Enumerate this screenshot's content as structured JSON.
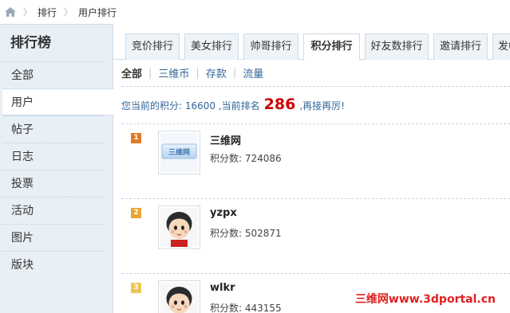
{
  "breadcrumb": {
    "items": [
      "排行",
      "用户排行"
    ],
    "separator": "〉"
  },
  "sidebar": {
    "title": "排行榜",
    "items": [
      {
        "label": "全部"
      },
      {
        "label": "用户"
      },
      {
        "label": "帖子"
      },
      {
        "label": "日志"
      },
      {
        "label": "投票"
      },
      {
        "label": "活动"
      },
      {
        "label": "图片"
      },
      {
        "label": "版块"
      }
    ],
    "active_index": 1
  },
  "tabs": {
    "items": [
      {
        "label": "竞价排行"
      },
      {
        "label": "美女排行"
      },
      {
        "label": "帅哥排行"
      },
      {
        "label": "积分排行"
      },
      {
        "label": "好友数排行"
      },
      {
        "label": "邀请排行"
      },
      {
        "label": "发帖"
      }
    ],
    "active_index": 3
  },
  "subnav": {
    "items": [
      {
        "label": "全部"
      },
      {
        "label": "三维币"
      },
      {
        "label": "存款"
      },
      {
        "label": "流量"
      }
    ],
    "separator": "|"
  },
  "score_line": {
    "prefix": "您当前的积分: 16600 ,当前排名",
    "rank": "286",
    "suffix": ",再接再厉!"
  },
  "ranking": [
    {
      "rank": "1",
      "name": "三维网",
      "score": "积分数: 724086",
      "badge_color": "#e07a29",
      "avatar_icon": "site-logo-icon"
    },
    {
      "rank": "2",
      "name": "yzpx",
      "score": "积分数: 502871",
      "badge_color": "#e9a630",
      "avatar_icon": "cartoon-avatar-icon"
    },
    {
      "rank": "3",
      "name": "wlkr",
      "score": "积分数: 443155",
      "badge_color": "#eec658",
      "avatar_icon": "cartoon-avatar-icon"
    }
  ],
  "logo_text": "三维网",
  "watermark": "三维网www.3dportal.cn"
}
